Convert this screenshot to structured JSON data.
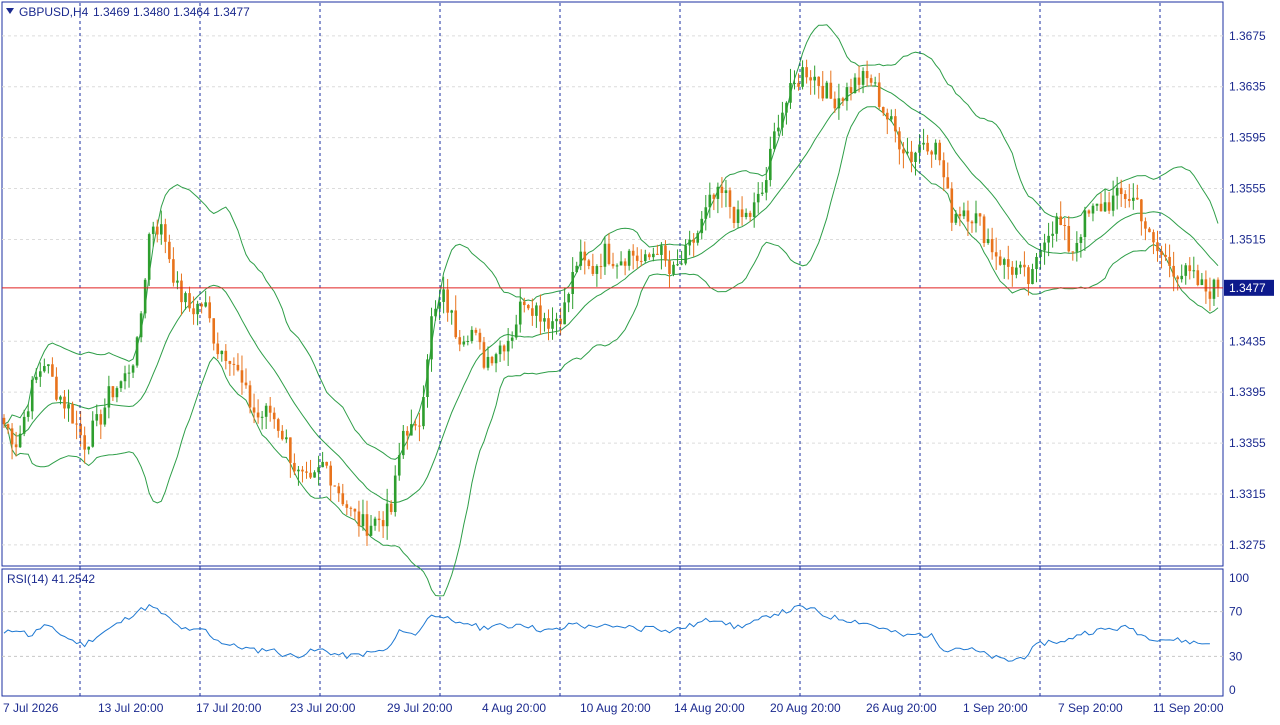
{
  "header": {
    "symbol_label": "GBPUSD,H4",
    "ohlc_label": "1.3469 1.3480 1.3464 1.3477"
  },
  "price_pane": {
    "current_price_label": "1.3477",
    "price_axis_labels": [
      "1.3675",
      "1.3635",
      "1.3595",
      "1.3555",
      "1.3515",
      "1.3435",
      "1.3395",
      "1.3355",
      "1.3315",
      "1.3275"
    ],
    "price_axis_values": [
      1.3675,
      1.3635,
      1.3595,
      1.3555,
      1.3515,
      1.3435,
      1.3395,
      1.3355,
      1.3315,
      1.3275
    ],
    "grid": true
  },
  "rsi_pane": {
    "label": "RSI(14) 41.2542",
    "axis_labels": [
      "100",
      "70",
      "30",
      "0"
    ],
    "axis_values": [
      100,
      70,
      30,
      0
    ],
    "levels": [
      70,
      30
    ]
  },
  "time_axis": {
    "labels": [
      "7 Jul 2026",
      "13 Jul 20:00",
      "17 Jul 20:00",
      "23 Jul 20:00",
      "29 Jul 20:00",
      "4 Aug 20:00",
      "10 Aug 20:00",
      "14 Aug 20:00",
      "20 Aug 20:00",
      "26 Aug 20:00",
      "1 Sep 20:00",
      "7 Sep 20:00",
      "11 Sep 20:00"
    ]
  },
  "colors": {
    "bull": "#2e9e2e",
    "bear": "#e8731c",
    "bands": "#2e9e48",
    "rsi": "#1e78d2",
    "price_line": "#e02020",
    "separator": "#1b2fa0",
    "axis_text": "#1b2a8f"
  },
  "chart_data": [
    {
      "type": "candlestick",
      "title": "GBPUSD,H4",
      "indicators": [
        "Bollinger Bands"
      ],
      "ylim": [
        1.326,
        1.37
      ],
      "last_price": 1.3477,
      "x_labels": [
        "7 Jul 2026",
        "13 Jul 20:00",
        "17 Jul 20:00",
        "23 Jul 20:00",
        "29 Jul 20:00",
        "4 Aug 20:00",
        "10 Aug 20:00",
        "14 Aug 20:00",
        "20 Aug 20:00",
        "26 Aug 20:00",
        "1 Sep 20:00",
        "7 Sep 20:00",
        "11 Sep 20:00"
      ],
      "close_path": [
        1.337,
        1.3355,
        1.3395,
        1.342,
        1.3395,
        1.338,
        1.3355,
        1.337,
        1.3395,
        1.3405,
        1.343,
        1.353,
        1.352,
        1.3475,
        1.346,
        1.3465,
        1.343,
        1.3425,
        1.3395,
        1.3375,
        1.338,
        1.336,
        1.333,
        1.332,
        1.334,
        1.332,
        1.33,
        1.329,
        1.3295,
        1.33,
        1.337,
        1.336,
        1.345,
        1.347,
        1.344,
        1.3445,
        1.342,
        1.343,
        1.344,
        1.347,
        1.346,
        1.345,
        1.346,
        1.35,
        1.349,
        1.3505,
        1.35,
        1.3505,
        1.3495,
        1.351,
        1.3485,
        1.35,
        1.352,
        1.3545,
        1.355,
        1.353,
        1.3535,
        1.3555,
        1.361,
        1.363,
        1.365,
        1.364,
        1.3625,
        1.363,
        1.364,
        1.364,
        1.3615,
        1.3595,
        1.358,
        1.3595,
        1.3585,
        1.3535,
        1.354,
        1.353,
        1.351,
        1.3495,
        1.349,
        1.348,
        1.352,
        1.353,
        1.3505,
        1.353,
        1.354,
        1.3545,
        1.355,
        1.3545,
        1.351,
        1.35,
        1.349,
        1.3485,
        1.3475,
        1.3477
      ]
    },
    {
      "type": "line",
      "title": "RSI(14)",
      "last_value": 41.2542,
      "ylim": [
        0,
        100
      ],
      "levels": [
        70,
        30
      ],
      "values": [
        50,
        55,
        48,
        58,
        52,
        45,
        40,
        48,
        55,
        62,
        70,
        75,
        68,
        58,
        52,
        55,
        45,
        40,
        38,
        35,
        37,
        32,
        30,
        34,
        36,
        32,
        30,
        32,
        34,
        36,
        55,
        48,
        65,
        68,
        58,
        60,
        55,
        58,
        56,
        60,
        55,
        53,
        54,
        60,
        56,
        58,
        55,
        57,
        54,
        58,
        52,
        55,
        58,
        62,
        64,
        56,
        58,
        62,
        68,
        70,
        74,
        72,
        66,
        64,
        62,
        60,
        56,
        52,
        48,
        50,
        48,
        36,
        38,
        36,
        32,
        28,
        26,
        30,
        40,
        44,
        42,
        50,
        52,
        54,
        55,
        56,
        48,
        46,
        45,
        44,
        42,
        41.25
      ]
    }
  ]
}
